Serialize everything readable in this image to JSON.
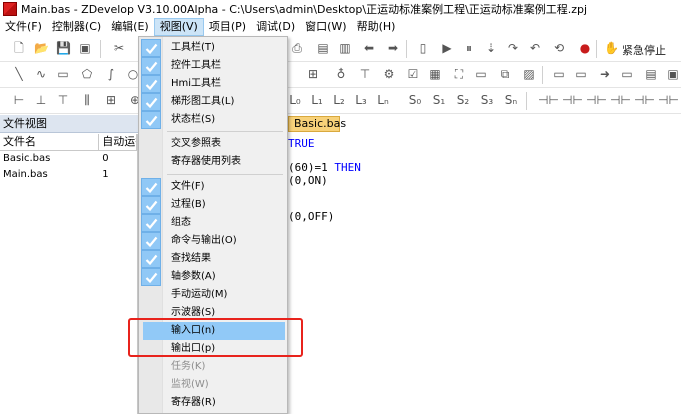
{
  "title": "Main.bas - ZDevelop V3.10.00Alpha - C:\\Users\\admin\\Desktop\\正运动标准案例工程\\正运动标准案例工程.zpj",
  "menu": [
    "文件(F)",
    "控制器(C)",
    "编辑(E)",
    "视图(V)",
    "项目(P)",
    "调试(D)",
    "窗口(W)",
    "帮助(H)"
  ],
  "toolbar": {
    "emergency_stop_label": "紧急停止"
  },
  "axis_buttons": [
    "L₀",
    "L₁",
    "L₂",
    "L₃",
    "Lₙ",
    "S₀",
    "S₁",
    "S₂",
    "S₃",
    "Sₙ"
  ],
  "file_view": {
    "title": "文件视图",
    "columns": [
      "文件名",
      "自动运行"
    ],
    "rows": [
      {
        "name": "Basic.bas",
        "autorun": "0"
      },
      {
        "name": "Main.bas",
        "autorun": "1"
      }
    ]
  },
  "editor": {
    "tab": "Basic.bas",
    "line1": "TRUE",
    "line2_num": "(60)=1 ",
    "line2_kw": "THEN",
    "line3": "(0,ON)",
    "line4": "(0,OFF)"
  },
  "view_menu": [
    {
      "label": "工具栏(T)",
      "checked": true
    },
    {
      "label": "控件工具栏",
      "checked": true
    },
    {
      "label": "Hmi工具栏",
      "checked": true
    },
    {
      "label": "梯形图工具(L)",
      "checked": true
    },
    {
      "label": "状态栏(S)",
      "checked": true
    },
    {
      "label": "交叉参照表",
      "checked": false
    },
    {
      "label": "寄存器使用列表",
      "checked": false
    },
    {
      "label": "文件(F)",
      "checked": true
    },
    {
      "label": "过程(B)",
      "checked": true
    },
    {
      "label": "组态",
      "checked": true
    },
    {
      "label": "命令与输出(O)",
      "checked": true
    },
    {
      "label": "查找结果",
      "checked": true
    },
    {
      "label": "轴参数(A)",
      "checked": true
    },
    {
      "label": "手动运动(M)",
      "checked": false
    },
    {
      "label": "示波器(S)",
      "checked": false
    },
    {
      "label": "输入口(n)",
      "checked": false,
      "highlighted": true
    },
    {
      "label": "输出口(p)",
      "checked": false
    },
    {
      "label": "任务(K)",
      "checked": false,
      "disabled": true
    },
    {
      "label": "监视(W)",
      "checked": false,
      "disabled": true
    },
    {
      "label": "寄存器(R)",
      "checked": false
    }
  ],
  "colors": {
    "highlight": "#91c9f7",
    "annotation_box": "#e8231c",
    "editor_tab": "#f8d27a"
  }
}
